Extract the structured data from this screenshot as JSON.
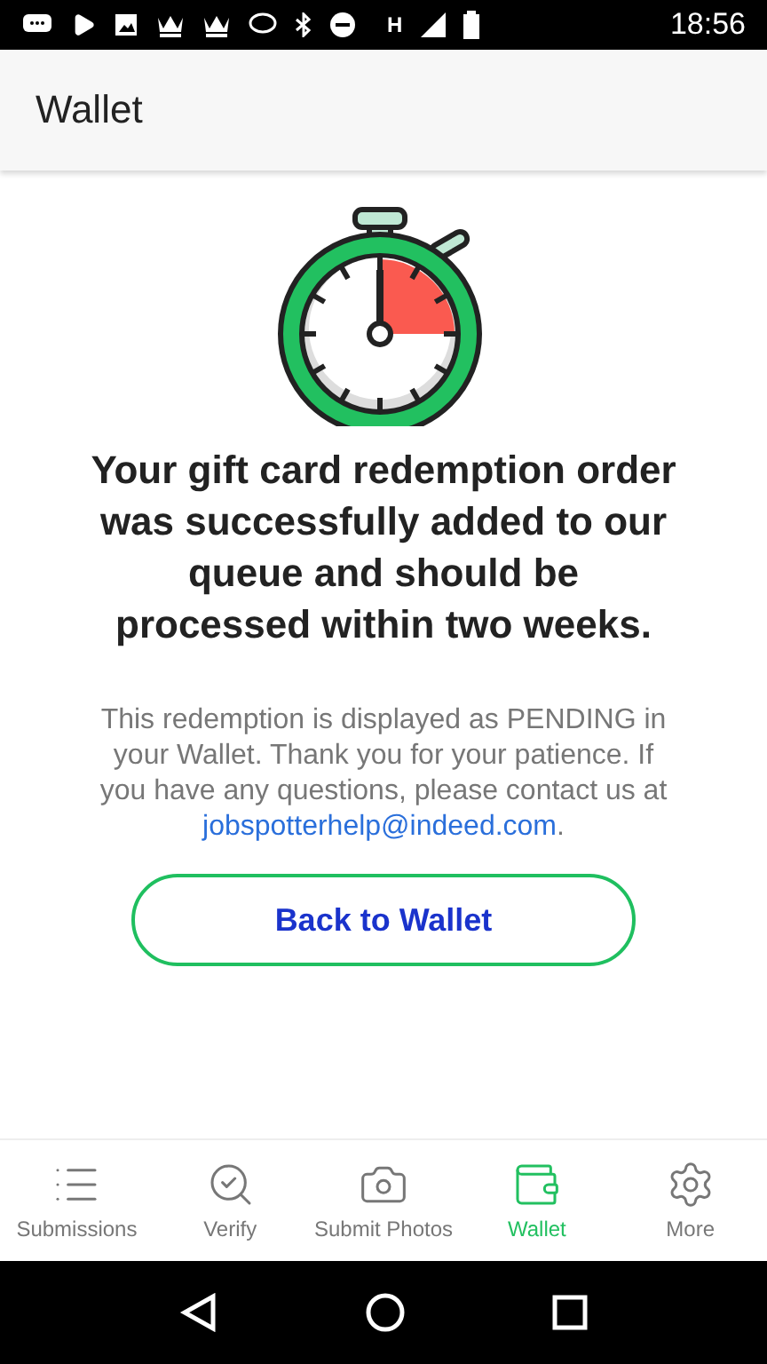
{
  "status_bar": {
    "network_type": "H",
    "time": "18:56"
  },
  "app_bar": {
    "title": "Wallet"
  },
  "confirmation": {
    "heading": "Your gift card redemption order was successfully added to our queue and should be processed within two weeks.",
    "body": "This redemption is displayed as PENDING in your Wallet. Thank you for your patience. If you have any questions, please contact us at",
    "email": "jobspotterhelp@indeed.com",
    "body_end": ".",
    "button": "Back to Wallet"
  },
  "bottom_nav": [
    {
      "kind": "list",
      "label": "Submissions",
      "selected": false
    },
    {
      "kind": "verify",
      "label": "Verify",
      "selected": false
    },
    {
      "kind": "camera",
      "label": "Submit Photos",
      "selected": false
    },
    {
      "kind": "wallet",
      "label": "Wallet",
      "selected": true
    },
    {
      "kind": "gear",
      "label": "More",
      "selected": false
    }
  ]
}
